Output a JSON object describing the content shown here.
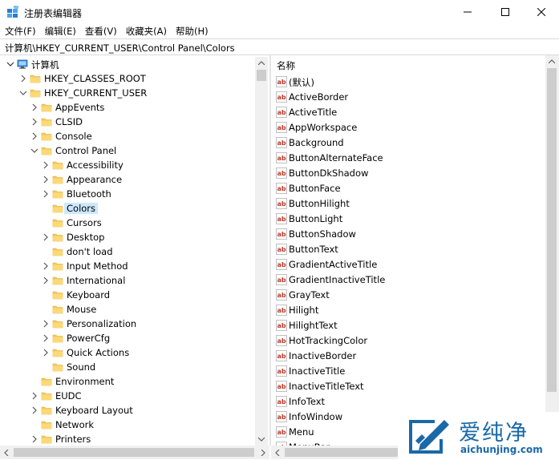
{
  "window": {
    "title": "注册表编辑器",
    "minimize_icon": "minimize-icon",
    "maximize_icon": "maximize-icon",
    "close_icon": "close-icon"
  },
  "menu": [
    "文件(F)",
    "编辑(E)",
    "查看(V)",
    "收藏夹(A)",
    "帮助(H)"
  ],
  "address": "计算机\\HKEY_CURRENT_USER\\Control Panel\\Colors",
  "tree": {
    "root": "计算机",
    "nodes": [
      {
        "label": "HKEY_CLASSES_ROOT",
        "depth": 1,
        "expanded": false
      },
      {
        "label": "HKEY_CURRENT_USER",
        "depth": 1,
        "expanded": true
      },
      {
        "label": "AppEvents",
        "depth": 2,
        "expanded": false
      },
      {
        "label": "CLSID",
        "depth": 2,
        "expanded": false
      },
      {
        "label": "Console",
        "depth": 2,
        "expanded": false
      },
      {
        "label": "Control Panel",
        "depth": 2,
        "expanded": true
      },
      {
        "label": "Accessibility",
        "depth": 3,
        "expanded": false
      },
      {
        "label": "Appearance",
        "depth": 3,
        "expanded": false
      },
      {
        "label": "Bluetooth",
        "depth": 3,
        "expanded": false
      },
      {
        "label": "Colors",
        "depth": 3,
        "expanded": null,
        "selected": true
      },
      {
        "label": "Cursors",
        "depth": 3,
        "expanded": null
      },
      {
        "label": "Desktop",
        "depth": 3,
        "expanded": false
      },
      {
        "label": "don't load",
        "depth": 3,
        "expanded": null
      },
      {
        "label": "Input Method",
        "depth": 3,
        "expanded": false
      },
      {
        "label": "International",
        "depth": 3,
        "expanded": false
      },
      {
        "label": "Keyboard",
        "depth": 3,
        "expanded": null
      },
      {
        "label": "Mouse",
        "depth": 3,
        "expanded": null
      },
      {
        "label": "Personalization",
        "depth": 3,
        "expanded": false
      },
      {
        "label": "PowerCfg",
        "depth": 3,
        "expanded": false
      },
      {
        "label": "Quick Actions",
        "depth": 3,
        "expanded": false
      },
      {
        "label": "Sound",
        "depth": 3,
        "expanded": null
      },
      {
        "label": "Environment",
        "depth": 2,
        "expanded": null
      },
      {
        "label": "EUDC",
        "depth": 2,
        "expanded": false
      },
      {
        "label": "Keyboard Layout",
        "depth": 2,
        "expanded": false
      },
      {
        "label": "Network",
        "depth": 2,
        "expanded": null
      },
      {
        "label": "Printers",
        "depth": 2,
        "expanded": false
      }
    ]
  },
  "values": {
    "header": "名称",
    "items": [
      "(默认)",
      "ActiveBorder",
      "ActiveTitle",
      "AppWorkspace",
      "Background",
      "ButtonAlternateFace",
      "ButtonDkShadow",
      "ButtonFace",
      "ButtonHilight",
      "ButtonLight",
      "ButtonShadow",
      "ButtonText",
      "GradientActiveTitle",
      "GradientInactiveTitle",
      "GrayText",
      "Hilight",
      "HilightText",
      "HotTrackingColor",
      "InactiveBorder",
      "InactiveTitle",
      "InactiveTitleText",
      "InfoText",
      "InfoWindow",
      "Menu",
      "MenuBar"
    ]
  },
  "watermark": {
    "text": "爱纯净",
    "url": "aichunjing.com"
  },
  "colors": {
    "folder": "#f4c95d",
    "folder_dark": "#dfa93a",
    "selection": "#cce8ff",
    "watermark": "#1a68a8",
    "ab_red": "#c0392b"
  }
}
